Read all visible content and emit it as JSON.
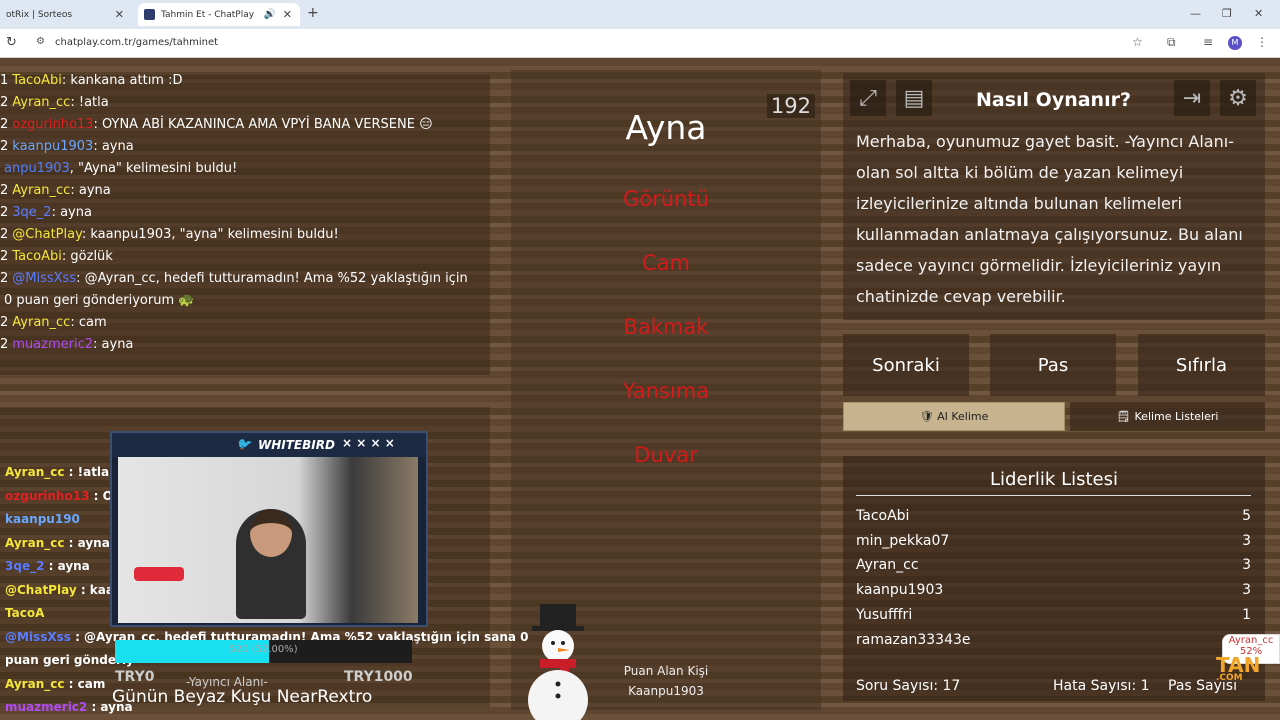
{
  "browser": {
    "tabs": [
      {
        "label": "otRix | Sorteos"
      },
      {
        "label": "Tahmin Et - ChatPlay"
      }
    ],
    "url": "chatplay.com.tr/games/tahminet",
    "profile_initial": "M"
  },
  "chat_top": [
    {
      "prefix": "1",
      "user": "TacoAbi",
      "user_color": "#f5e73a",
      "text": ": kankana attım :D"
    },
    {
      "prefix": "2",
      "user": "Ayran_cc",
      "user_color": "#f5e73a",
      "text": ": !atla"
    },
    {
      "prefix": "2",
      "user": "ozgurinho13",
      "user_color": "#e02121",
      "text": ": OYNA ABİ KAZANINCA AMA VPYİ BANA VERSENE 😑"
    },
    {
      "prefix": "2",
      "user": "kaanpu1903",
      "user_color": "#6aa8ff",
      "text": ": ayna"
    },
    {
      "prefix": "",
      "user": "anpu1903",
      "user_color": "#4f7fff",
      "text": ", \"Ayna\" kelimesini buldu!"
    },
    {
      "prefix": "2",
      "user": "Ayran_cc",
      "user_color": "#f5e73a",
      "text": ": ayna"
    },
    {
      "prefix": "2",
      "user": "3qe_2",
      "user_color": "#5a7dff",
      "text": ": ayna"
    },
    {
      "prefix": "2",
      "user": "@ChatPlay",
      "user_color": "#f5e73a",
      "text": ": kaanpu1903, \"ayna\" kelimesini buldu!"
    },
    {
      "prefix": "2",
      "user": "TacoAbi",
      "user_color": "#f5e73a",
      "text": ": gözlük"
    },
    {
      "prefix": "2",
      "user": "@MissXss",
      "user_color": "#5a7dff",
      "text": ": @Ayran_cc, hedefi tutturamadın! Ama %52 yaklaştığın için"
    },
    {
      "prefix": "",
      "user": "",
      "user_color": "#ffffff",
      "text": "0 puan geri gönderiyorum 🐢"
    },
    {
      "prefix": "2",
      "user": "Ayran_cc",
      "user_color": "#f5e73a",
      "text": ": cam"
    },
    {
      "prefix": "2",
      "user": "muazmeric2",
      "user_color": "#b04cf0",
      "text": ": ayna"
    }
  ],
  "game": {
    "target_word": "Ayna",
    "timer": "192",
    "taboo_words": [
      "Görüntü",
      "Cam",
      "Bakmak",
      "Yansıma",
      "Duvar"
    ],
    "winner_label": "Puan Alan Kişi",
    "winner_name": "Kaanpu1903"
  },
  "howto": {
    "title": "Nasıl Oynanır?",
    "text": "Merhaba, oyunumuz gayet basit. -Yayıncı Alanı- olan sol altta ki bölüm de yazan kelimeyi izleyicilerinize altında bulunan kelimeleri kullanmadan anlatmaya çalışıyorsunuz. Bu alanı sadece yayıncı görmelidir. İzleyicileriniz yayın chatinizde cevap verebilir."
  },
  "buttons": {
    "next": "Sonraki",
    "pass": "Pas",
    "reset": "Sıfırla",
    "ai_word": "🛡 AI Kelime",
    "word_lists": "Kelime Listeleri"
  },
  "leaderboard": {
    "title": "Liderlik Listesi",
    "rows": [
      {
        "name": "TacoAbi",
        "score": "5"
      },
      {
        "name": "min_pekka07",
        "score": "3"
      },
      {
        "name": "Ayran_cc",
        "score": "3"
      },
      {
        "name": "kaanpu1903",
        "score": "3"
      },
      {
        "name": "Yusufffri",
        "score": "1"
      },
      {
        "name": "ramazan33343e",
        "score": ""
      }
    ],
    "question_count": "Soru Sayısı: 17",
    "error_count": "Hata Sayısı: 1",
    "pass_count": "Pas Sayısı"
  },
  "stream_chat": [
    {
      "user": "Ayran_cc",
      "color": "#f5e73a",
      "text": " : !atla"
    },
    {
      "user": "ozgurinho13",
      "color": "#e02121",
      "text": " : OY"
    },
    {
      "user": "kaanpu190",
      "color": "#6aa8ff",
      "text": ""
    },
    {
      "user": "Ayran_cc",
      "color": "#f5e73a",
      "text": " : ayna"
    },
    {
      "user": "3qe_2",
      "color": "#5a7dff",
      "text": " : ayna"
    },
    {
      "user": "@ChatPlay",
      "color": "#f5e73a",
      "text": " : kaan"
    },
    {
      "user": "TacoA",
      "color": "#f5e73a",
      "text": ""
    },
    {
      "user": "@MissXss",
      "color": "#5a7dff",
      "text": " : @Ayran_cc, hedefi tutturamadın! Ama %52 yaklaştığın için sana 0"
    },
    {
      "user": "puan geri gönderiy",
      "color": "#ffffff",
      "text": ""
    },
    {
      "user": "Ayran_cc",
      "color": "#f5e73a",
      "text": " : cam"
    },
    {
      "user": "muazmeric2",
      "color": "#b04cf0",
      "text": " : ayna"
    }
  ],
  "overlay": {
    "cam_header": "WHITEBIRD",
    "progress_text": "520 (52.00%)",
    "progress_fraction": 0.52,
    "try_left": "TRY0",
    "try_right": "TRY1000",
    "streamer_area": "-Yayıncı Alanı-",
    "caption": "Günün Beyaz Kuşu NearRextro",
    "badge_user": "Ayran_cc",
    "badge_pct": "52%",
    "logo": "TAN"
  }
}
